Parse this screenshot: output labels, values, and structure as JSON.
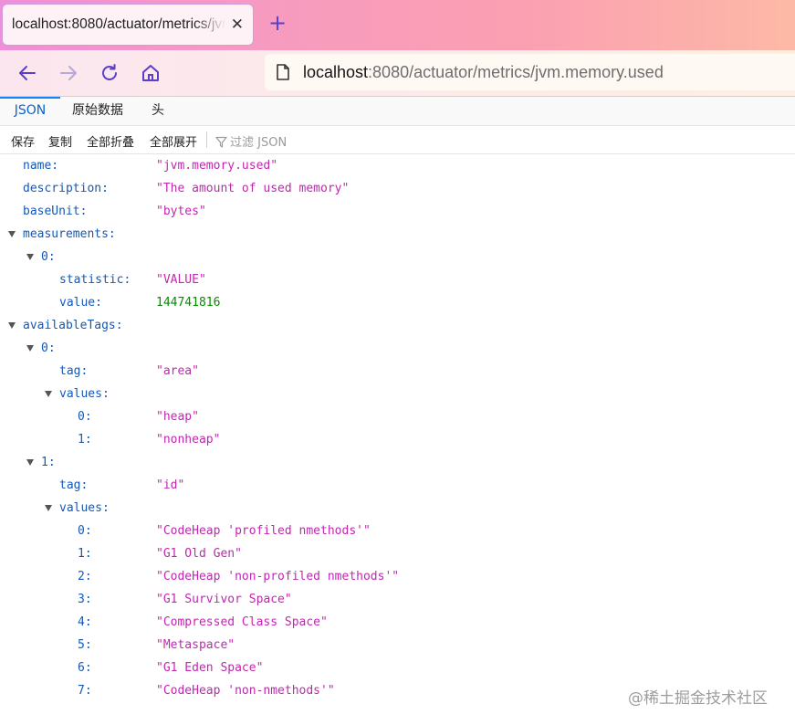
{
  "browser": {
    "tab_title": "localhost:8080/actuator/metrics/jvm.memory.used",
    "tab_close": "✕",
    "new_tab": "+",
    "url_host": "localhost",
    "url_rest": ":8080/actuator/metrics/jvm.memory.used"
  },
  "viewer": {
    "tabs": [
      "JSON",
      "原始数据",
      "头"
    ],
    "active_tab": "JSON",
    "toolbar": {
      "save": "保存",
      "copy": "复制",
      "collapse_all": "全部折叠",
      "expand_all": "全部展开",
      "filter_placeholder": "过滤 JSON"
    }
  },
  "json": {
    "name_key": "name:",
    "name_value": "\"jvm.memory.used\"",
    "description_key": "description:",
    "description_value": "\"The amount of used memory\"",
    "baseUnit_key": "baseUnit:",
    "baseUnit_value": "\"bytes\"",
    "measurements_key": "measurements:",
    "m0_key": "0:",
    "statistic_key": "statistic:",
    "statistic_value": "\"VALUE\"",
    "value_key": "value:",
    "value_value": "144741816",
    "availableTags_key": "availableTags:",
    "t0_key": "0:",
    "t0_tag_key": "tag:",
    "t0_tag_value": "\"area\"",
    "t0_values_key": "values:",
    "t0_values": [
      {
        "key": "0:",
        "value": "\"heap\""
      },
      {
        "key": "1:",
        "value": "\"nonheap\""
      }
    ],
    "t1_key": "1:",
    "t1_tag_key": "tag:",
    "t1_tag_value": "\"id\"",
    "t1_values_key": "values:",
    "t1_values": [
      {
        "key": "0:",
        "value": "\"CodeHeap 'profiled nmethods'\""
      },
      {
        "key": "1:",
        "value": "\"G1 Old Gen\""
      },
      {
        "key": "2:",
        "value": "\"CodeHeap 'non-profiled nmethods'\""
      },
      {
        "key": "3:",
        "value": "\"G1 Survivor Space\""
      },
      {
        "key": "4:",
        "value": "\"Compressed Class Space\""
      },
      {
        "key": "5:",
        "value": "\"Metaspace\""
      },
      {
        "key": "6:",
        "value": "\"G1 Eden Space\""
      },
      {
        "key": "7:",
        "value": "\"CodeHeap 'non-nmethods'\""
      }
    ]
  },
  "watermark": "@稀土掘金技术社区",
  "colors": {
    "key": "#1558b5",
    "string": "#c127b0",
    "number": "#058b00",
    "active_tab": "#0a62cf"
  }
}
